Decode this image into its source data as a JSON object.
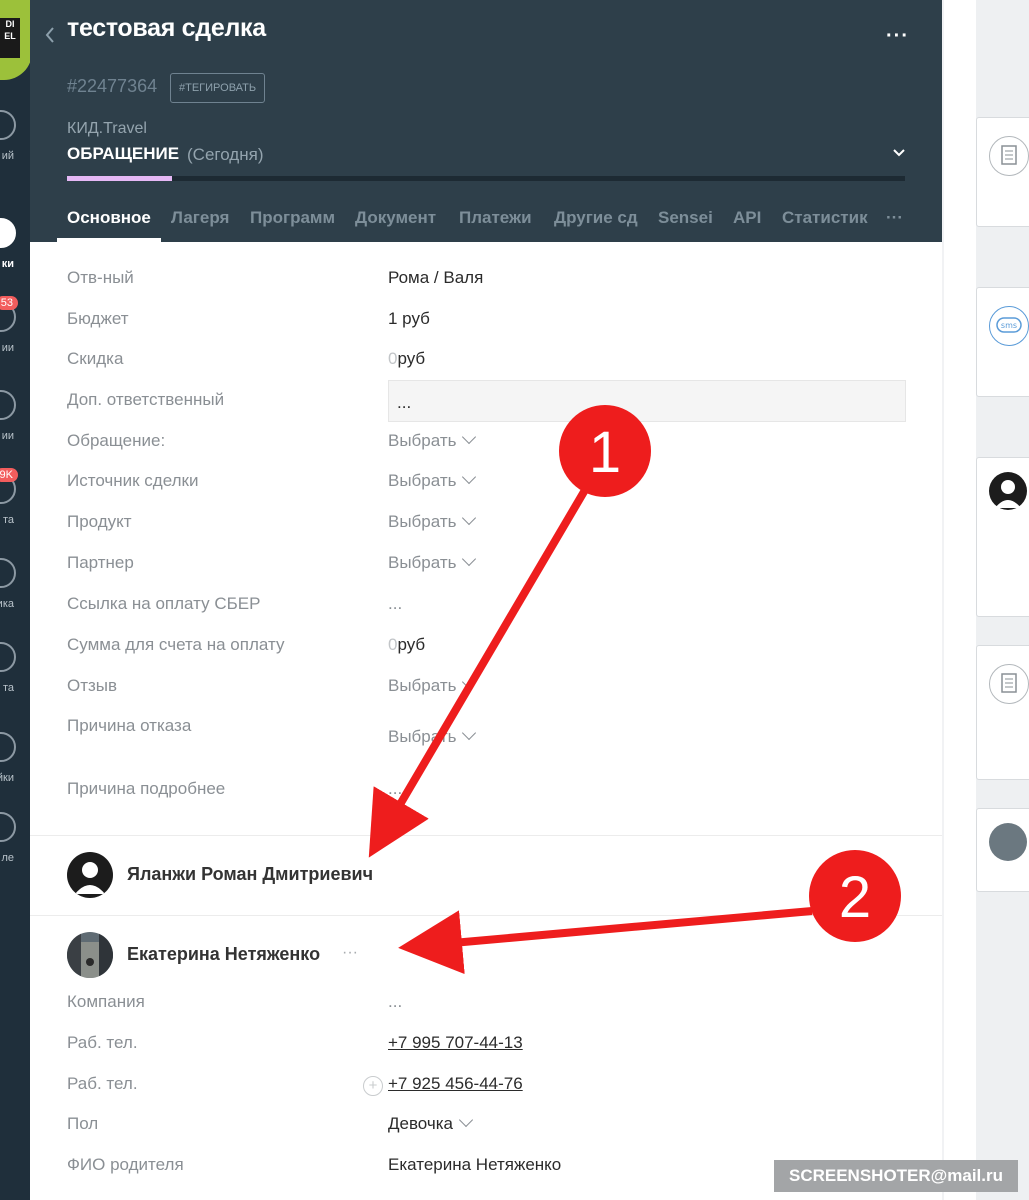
{
  "nav": {
    "items": [
      {
        "label": "ий",
        "badge": ""
      },
      {
        "label": "ки",
        "badge": "",
        "active": true
      },
      {
        "label": "ии",
        "badge": "53"
      },
      {
        "label": "ии",
        "badge": ""
      },
      {
        "label": "та",
        "badge": "9K"
      },
      {
        "label": "ика",
        "badge": ""
      },
      {
        "label": "та",
        "badge": ""
      },
      {
        "label": "йки",
        "badge": ""
      },
      {
        "label": "ле",
        "badge": ""
      }
    ]
  },
  "header": {
    "title": "тестовая сделка",
    "deal_id": "#22477364",
    "tag_button": "#ТЕГИРОВАТЬ",
    "pipeline": "КИД.Travel",
    "stage": "ОБРАЩЕНИЕ",
    "stage_date": "(Сегодня)",
    "stage_progress": 0.125
  },
  "tabs": [
    {
      "label": "Основное",
      "active": true
    },
    {
      "label": "Лагеря"
    },
    {
      "label": "Программ"
    },
    {
      "label": "Документ"
    },
    {
      "label": "Платежи"
    },
    {
      "label": "Другие сд"
    },
    {
      "label": "Sensei"
    },
    {
      "label": "API"
    },
    {
      "label": "Статистик"
    },
    {
      "label": "···"
    }
  ],
  "fields": {
    "responsible": {
      "label": "Отв-ный",
      "value": "Рома / Валя"
    },
    "budget": {
      "label": "Бюджет",
      "value": "1 руб"
    },
    "discount": {
      "label": "Скидка",
      "zero": "0",
      "unit": "руб"
    },
    "extra_responsible": {
      "label": "Доп. ответственный",
      "value": "..."
    },
    "appeal": {
      "label": "Обращение:",
      "value": "Выбрать"
    },
    "source": {
      "label": "Источник сделки",
      "value": "Выбрать"
    },
    "product": {
      "label": "Продукт",
      "value": "Выбрать"
    },
    "partner": {
      "label": "Партнер",
      "value": "Выбрать"
    },
    "sber_link": {
      "label": "Ссылка на оплату СБЕР",
      "value": "..."
    },
    "invoice_sum": {
      "label": "Сумма для счета на оплату",
      "zero": "0",
      "unit": "руб"
    },
    "review": {
      "label": "Отзыв",
      "value": "Выбрать"
    },
    "refusal_reason": {
      "label": "Причина отказа",
      "value": "Выбрать"
    },
    "refusal_details": {
      "label": "Причина подробнее",
      "value": "..."
    }
  },
  "contacts": [
    {
      "name": "Яланжи Роман Дмитриевич"
    },
    {
      "name": "Екатерина Нетяженко",
      "more": "···"
    }
  ],
  "contact_fields": {
    "company": {
      "label": "Компания",
      "value": "..."
    },
    "work_phone_1": {
      "label": "Раб. тел.",
      "value": "+7 995 707-44-13"
    },
    "work_phone_2": {
      "label": "Раб. тел.",
      "value": "+7 925 456-44-76"
    },
    "gender": {
      "label": "Пол",
      "value": "Девочка"
    },
    "parent_name": {
      "label": "ФИО родителя",
      "value": "Екатерина Нетяженко"
    }
  },
  "feed": {
    "sms_label": "sms"
  },
  "annotations": {
    "marker_1": "1",
    "marker_2": "2"
  },
  "watermark": "SCREENSHOTER@mail.ru",
  "colors": {
    "header_bg": "#2e3f4a",
    "nav_bg": "#1f2f3b",
    "stage_fill": "#e5b8f5",
    "annotation_red": "#ee1d1d",
    "badge_red": "#f25d5d"
  }
}
